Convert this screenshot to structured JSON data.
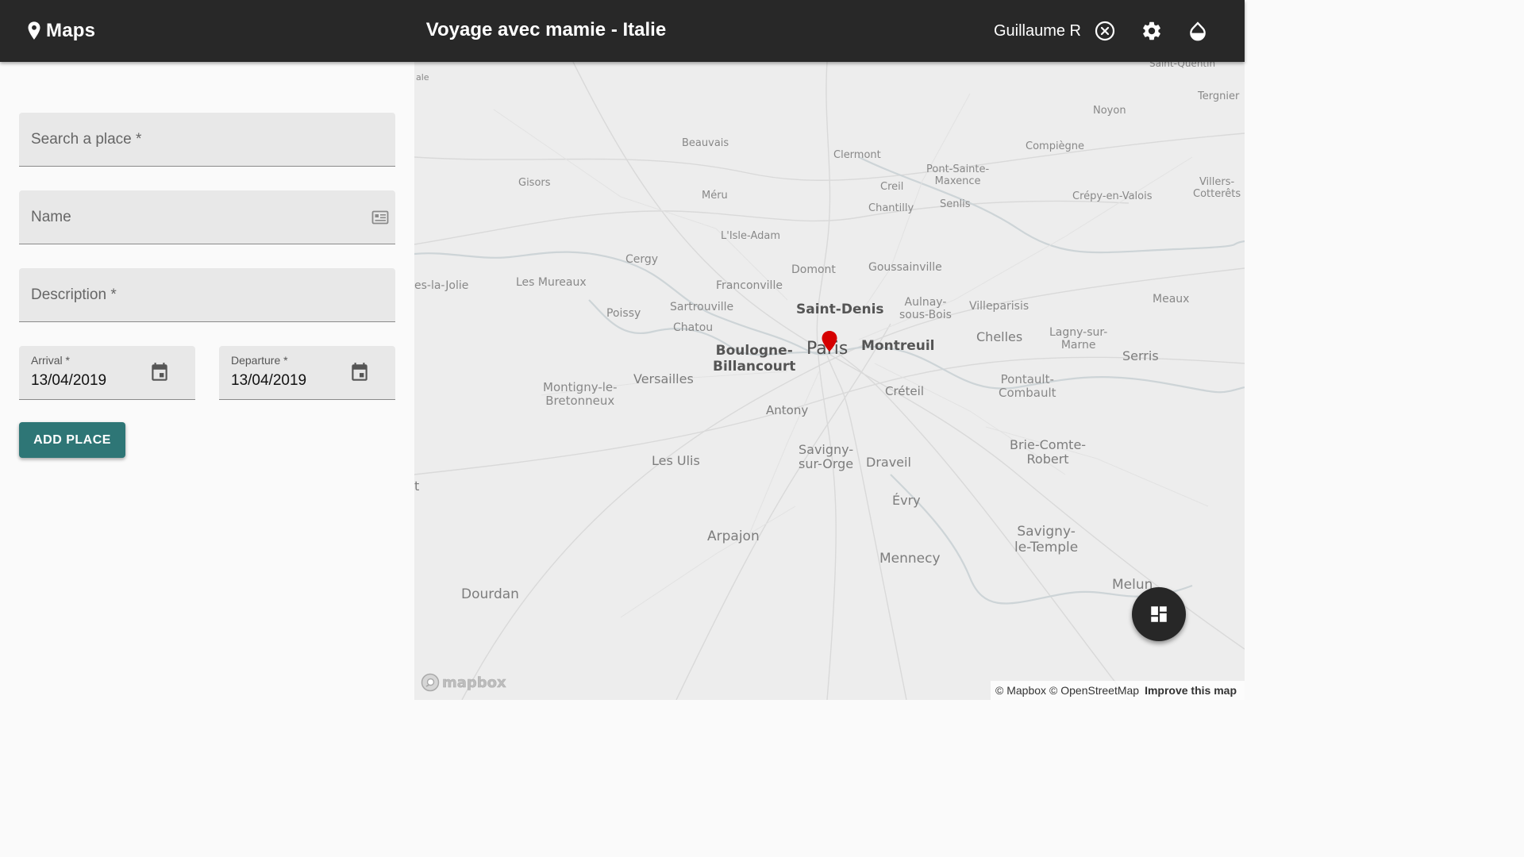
{
  "header": {
    "brand": "Maps",
    "trip_title": "Voyage avec mamie - Italie",
    "user_name": "Guillaume R",
    "icons": [
      "place-icon",
      "close-circle-icon",
      "settings-icon",
      "theme-drop-icon"
    ],
    "background": "#282828"
  },
  "form": {
    "search_placeholder": "Search a place *",
    "name_placeholder": "Name",
    "description_placeholder": "Description *",
    "arrival": {
      "label": "Arrival *",
      "value": "13/04/2019"
    },
    "departure": {
      "label": "Departure *",
      "value": "13/04/2019"
    },
    "add_button": "ADD PLACE",
    "accent": "#2e7676"
  },
  "map": {
    "places": {
      "ale": "ale",
      "saint_quentin": "Saint-Quentin",
      "tergnier": "Tergnier",
      "noyon": "Noyon",
      "beauvais": "Beauvais",
      "clermont": "Clermont",
      "compiegne": "Compiègne",
      "gisors": "Gisors",
      "meru": "Méru",
      "creil": "Creil",
      "pont_sainte_maxence_1": "Pont-Sainte-",
      "pont_sainte_maxence_2": "Maxence",
      "chantilly": "Chantilly",
      "senlis": "Senlis",
      "crepy": "Crépy-en-Valois",
      "villers_1": "Villers-",
      "villers_2": "Cotterêts",
      "lisle_adam": "L'Isle-Adam",
      "cergy": "Cergy",
      "domont": "Domont",
      "goussainville": "Goussainville",
      "la_jolie": "es-la-Jolie",
      "les_mureaux": "Les Mureaux",
      "franconville": "Franconville",
      "saint_denis": "Saint-Denis",
      "aulnay_1": "Aulnay-",
      "aulnay_2": "sous-Bois",
      "villeparisis": "Villeparisis",
      "meaux": "Meaux",
      "poissy": "Poissy",
      "sartrouville": "Sartrouville",
      "chatou": "Chatou",
      "boulogne_1": "Boulogne-",
      "boulogne_2": "Billancourt",
      "paris": "Paris",
      "montreuil": "Montreuil",
      "chelles": "Chelles",
      "lagny_1": "Lagny-sur-",
      "lagny_2": "Marne",
      "serris": "Serris",
      "montigny_1": "Montigny-le-",
      "montigny_2": "Bretonneux",
      "versailles": "Versailles",
      "antony": "Antony",
      "creteil": "Créteil",
      "pontault_1": "Pontault-",
      "pontault_2": "Combault",
      "les_ulis": "Les Ulis",
      "savigny_1": "Savigny-",
      "savigny_2": "sur-Orge",
      "draveil": "Draveil",
      "brie_1": "Brie-Comte-",
      "brie_2": "Robert",
      "evry": "Évry",
      "t": "t",
      "arpajon": "Arpajon",
      "savigny_temple_1": "Savigny-",
      "savigny_temple_2": "le-Temple",
      "mennecy": "Mennecy",
      "dourdan": "Dourdan",
      "melun": "Melun"
    },
    "marker_color": "#d50000",
    "fab_icon": "dashboard-icon",
    "logo": "mapbox",
    "attribution": {
      "mapbox": "© Mapbox",
      "osm": "© OpenStreetMap",
      "improve": "Improve this map"
    }
  }
}
